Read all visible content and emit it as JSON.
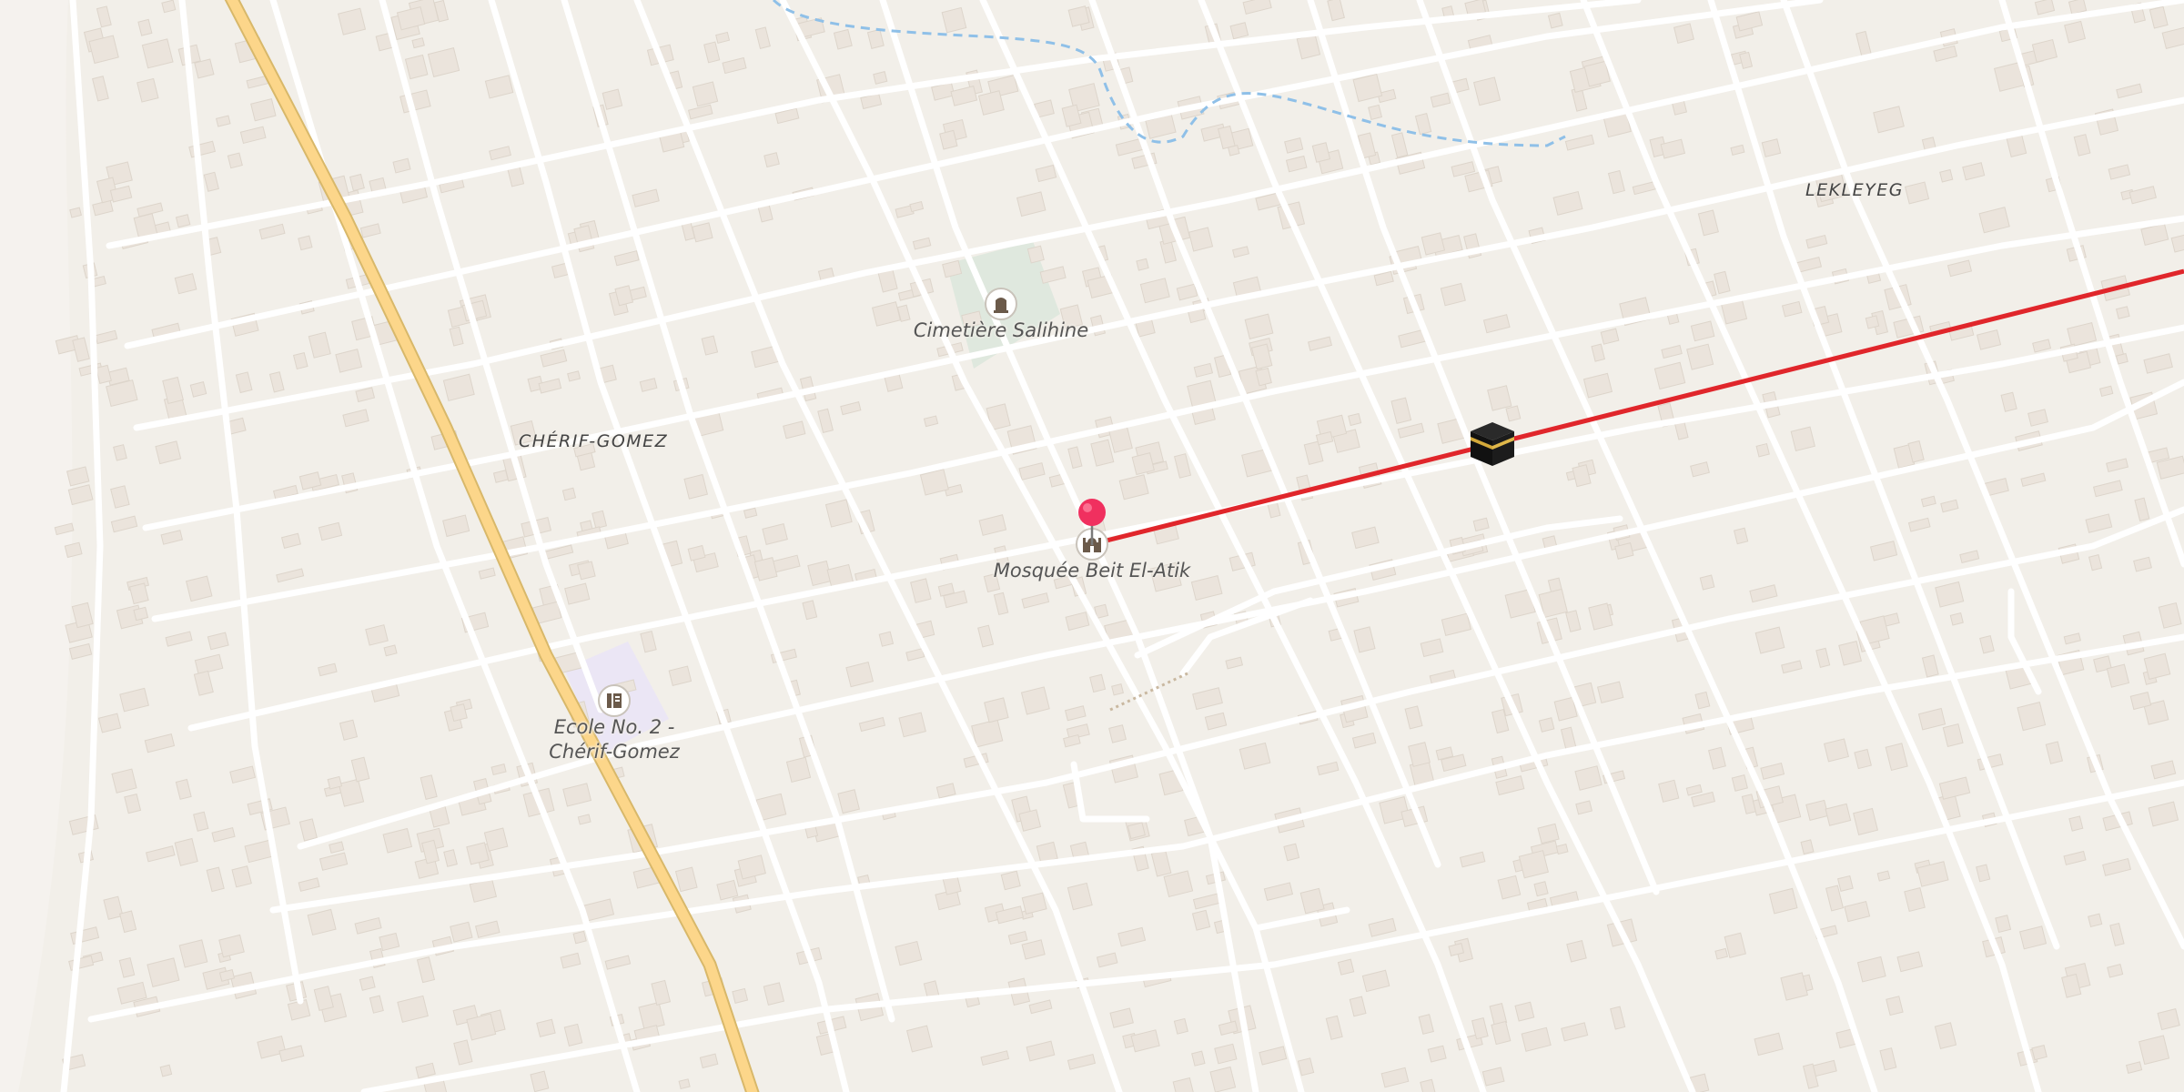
{
  "map": {
    "poi_labels": {
      "cemetery": "Cimetière Salihine",
      "mosque": "Mosquée Beit El-Atik",
      "school_line1": "Ecole No. 2 -",
      "school_line2": "Chérif-Gomez"
    },
    "area_labels": {
      "cherif_gomez": "CHÉRIF-GOMEZ",
      "lekleyeg": "LEKLEYEG"
    },
    "icons": {
      "cemetery": "cemetery-icon",
      "mosque": "mosque-icon",
      "school": "school-icon",
      "location_pin": "location-pin-icon",
      "kaaba": "kaaba-icon"
    },
    "colors": {
      "background": "#f2efe9",
      "road": "#ffffff",
      "major_road": "#fcd68a",
      "water": "#8fc0e8",
      "qibla_line": "#e0262b",
      "pin": "#f0305f",
      "cemetery_area": "#dce6dc",
      "school_area": "#ebe6f5"
    }
  }
}
